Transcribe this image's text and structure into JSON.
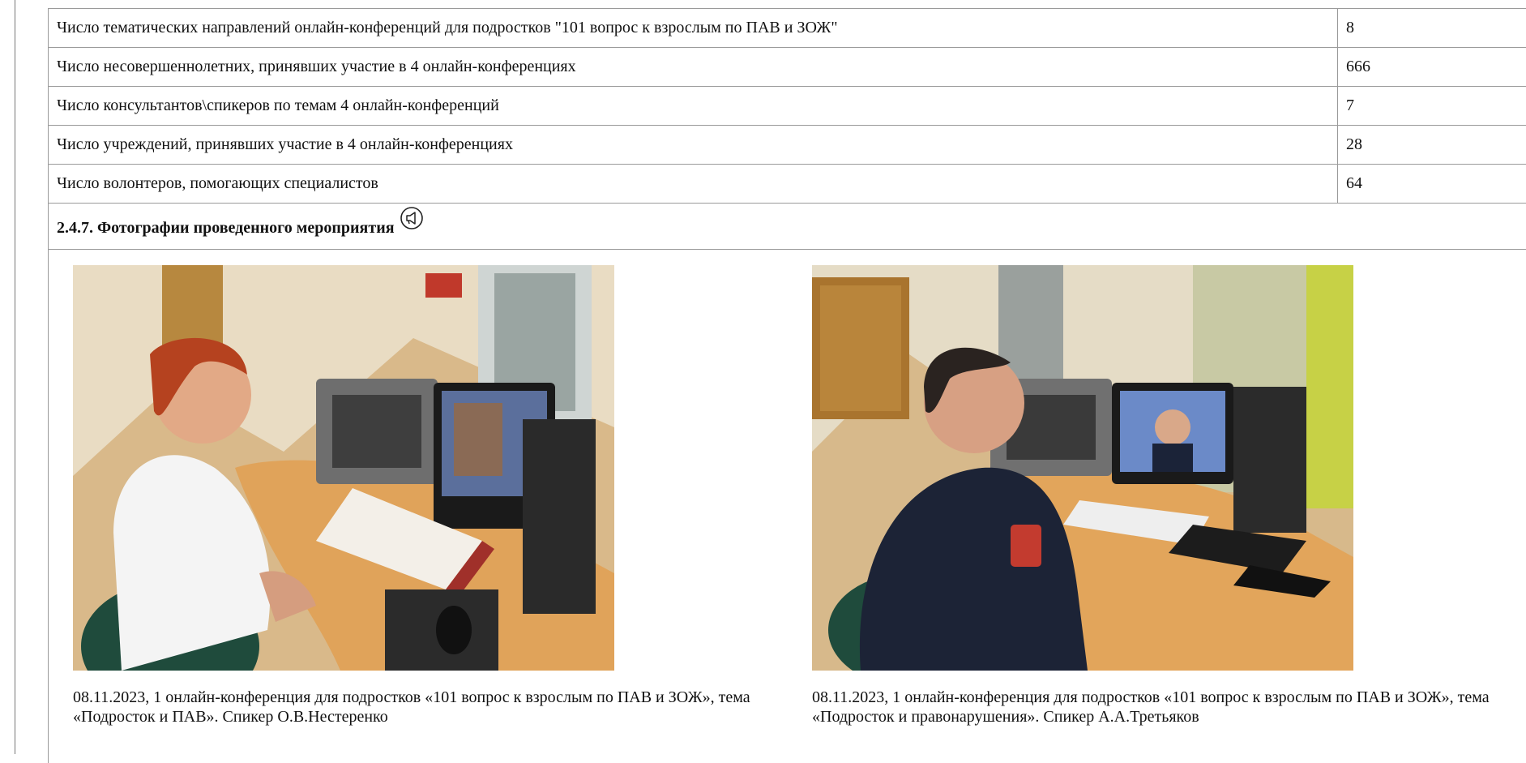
{
  "table": {
    "rows": [
      {
        "label": "Число тематических направлений онлайн-конференций для подростков \"101 вопрос к взрослым по ПАВ и ЗОЖ\"",
        "value": "8"
      },
      {
        "label": "Число несовершеннолетних, принявших участие в 4 онлайн-конференциях",
        "value": "666"
      },
      {
        "label": "Число консультантов\\спикеров по темам 4 онлайн-конференций",
        "value": "7"
      },
      {
        "label": "Число учреждений, принявших участие в 4 онлайн-конференциях",
        "value": "28"
      },
      {
        "label": "Число волонтеров, помогающих специалистов",
        "value": "64"
      }
    ]
  },
  "section": {
    "title": "2.4.7. Фотографии проведенного мероприятия"
  },
  "photos": [
    {
      "caption": "08.11.2023, 1 онлайн-конференция для подростков «101 вопрос к взрослым по ПАВ и ЗОЖ», тема «Подросток и ПАВ». Спикер О.В.Нестеренко"
    },
    {
      "caption": "08.11.2023, 1 онлайн-конференция для подростков «101 вопрос к взрослым по ПАВ и ЗОЖ», тема «Подросток и правонарушения». Спикер А.А.Третьяков"
    }
  ],
  "icons": {
    "section_badge": "megaphone-circle-icon"
  }
}
